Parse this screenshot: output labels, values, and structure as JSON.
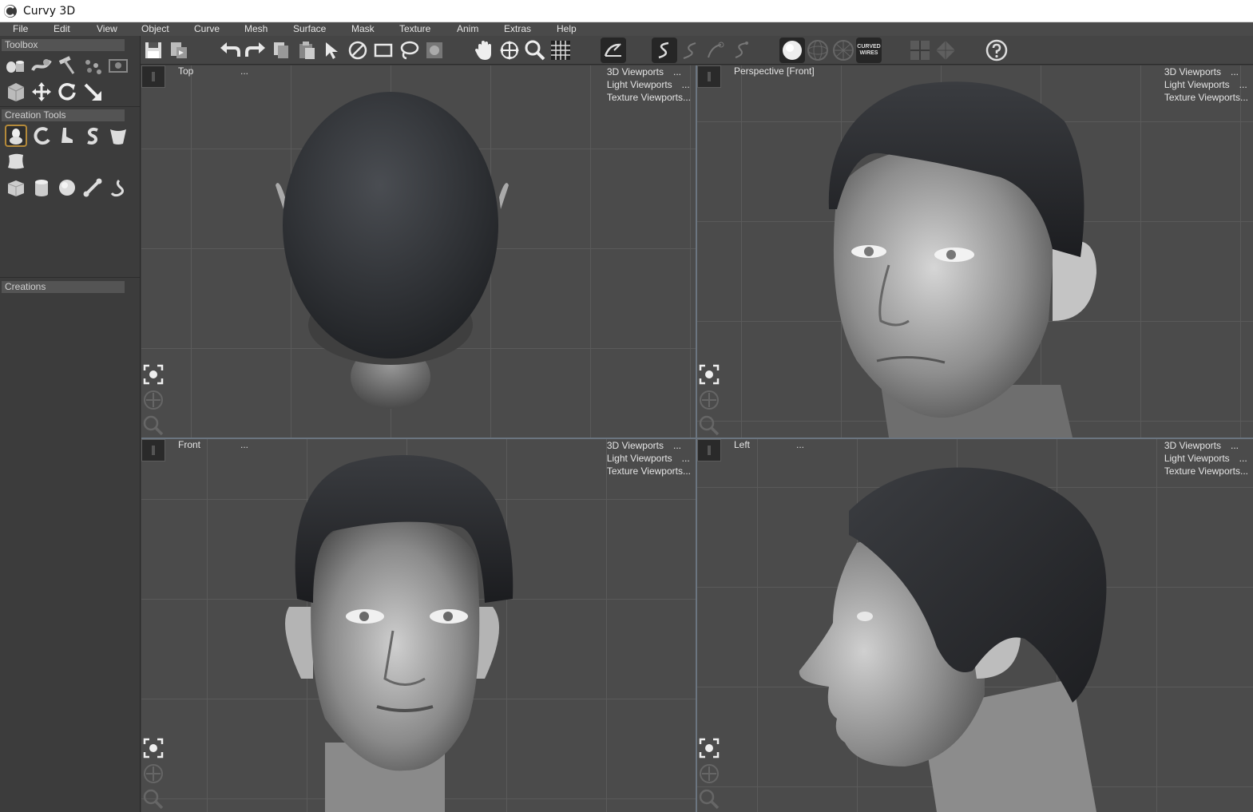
{
  "window": {
    "title": "Curvy 3D"
  },
  "menu": [
    "File",
    "Edit",
    "View",
    "Object",
    "Curve",
    "Mesh",
    "Surface",
    "Mask",
    "Texture",
    "Anim",
    "Extras",
    "Help"
  ],
  "left_panel": {
    "toolbox_label": "Toolbox",
    "creation_tools_label": "Creation Tools",
    "creations_label": "Creations"
  },
  "toolbar": {
    "curved_wires_line1": "CURVED",
    "curved_wires_line2": "WIRES"
  },
  "viewports": {
    "top": {
      "label": "Top",
      "dots": "...",
      "menu": [
        "3D Viewports",
        "Light Viewports",
        "Texture Viewports..."
      ],
      "menu_dots": [
        "...",
        "..."
      ]
    },
    "perspective": {
      "label": "Perspective [Front]",
      "menu": [
        "3D Viewports",
        "Light Viewports",
        "Texture Viewports..."
      ],
      "menu_dots": [
        "...",
        "..."
      ]
    },
    "front": {
      "label": "Front",
      "dots": "...",
      "menu": [
        "3D Viewports",
        "Light Viewports",
        "Texture Viewports..."
      ],
      "menu_dots": [
        "...",
        "..."
      ]
    },
    "left": {
      "label": "Left",
      "dots": "...",
      "menu": [
        "3D Viewports",
        "Light Viewports",
        "Texture Viewports..."
      ],
      "menu_dots": [
        "...",
        "..."
      ]
    }
  },
  "colors": {
    "background": "#3d3d3d",
    "viewport_bg": "#4b4b4b",
    "grid": "#5a5a5a",
    "selected_tool_border": "#b48a3a"
  }
}
